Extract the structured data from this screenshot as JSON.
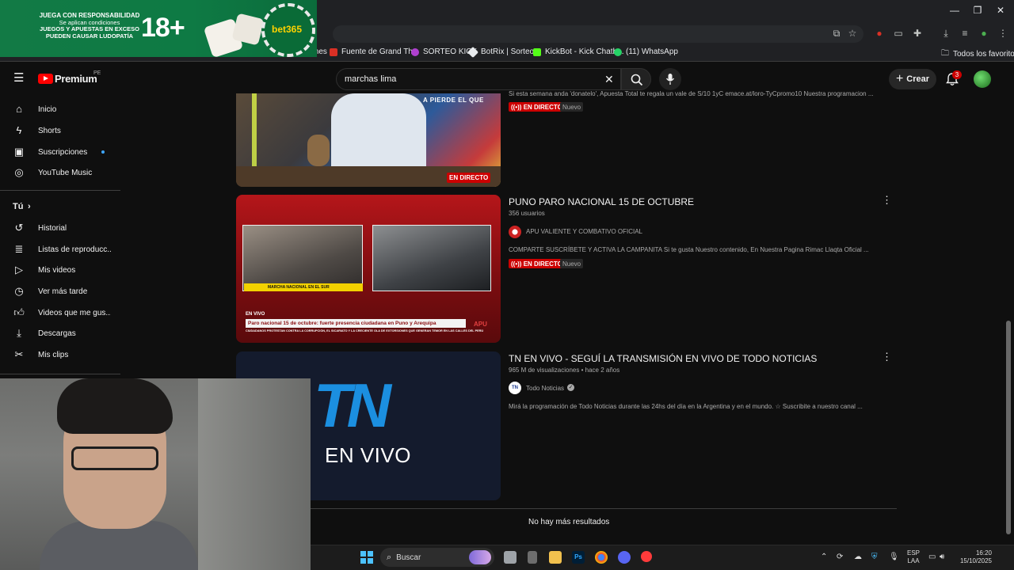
{
  "browser": {
    "bookmarks": [
      {
        "label": "ciones",
        "color": "#2f5fb3"
      },
      {
        "label": "Fuente de Grand Th...",
        "color": "#d93025"
      },
      {
        "label": "SORTEO KICK",
        "color": "#b040d0"
      },
      {
        "label": "BotRix | Sorteos",
        "color": "#e8eaed"
      },
      {
        "label": "KickBot - Kick Chatb...",
        "color": "#53fc18"
      },
      {
        "label": "(11) WhatsApp",
        "color": "#25d366"
      }
    ],
    "all_bookmarks_label": "Todos los favoritos"
  },
  "ad": {
    "line1": "JUEGA CON RESPONSABILIDAD",
    "line2": "Se aplican condiciones",
    "line3": "JUEGOS Y APUESTAS EN EXCESO",
    "line4": "PUEDEN CAUSAR LUDOPATÍA",
    "age": "18+",
    "brand": "bet365"
  },
  "header": {
    "logo_text": "Premium",
    "region": "PE",
    "search_value": "marchas lima",
    "create_label": "Crear",
    "notifications_count": "3"
  },
  "sidebar": {
    "items": [
      {
        "label": "Inicio",
        "icon": "home-icon"
      },
      {
        "label": "Shorts",
        "icon": "shorts-icon"
      },
      {
        "label": "Suscripciones",
        "icon": "subscriptions-icon"
      },
      {
        "label": "YouTube Music",
        "icon": "music-icon"
      }
    ],
    "you_label": "Tú",
    "you_items": [
      {
        "label": "Historial",
        "icon": "history-icon"
      },
      {
        "label": "Listas de reproducc...",
        "icon": "playlists-icon"
      },
      {
        "label": "Mis videos",
        "icon": "my-videos-icon"
      },
      {
        "label": "Ver más tarde",
        "icon": "watch-later-icon"
      },
      {
        "label": "Videos que me gus...",
        "icon": "liked-icon"
      },
      {
        "label": "Descargas",
        "icon": "downloads-icon"
      },
      {
        "label": "Mis clips",
        "icon": "clips-icon"
      }
    ]
  },
  "results": [
    {
      "description": "Si esta semana anda 'donatelo', Apuesta Total te regala un vale de S/10 1yC emace.at/loro-TyCpromo10 Nuestra programacion ...",
      "live_label": "EN DIRECTO",
      "new_label": "Nuevo",
      "thumb_live_label": "EN DIRECTO",
      "thumb_banner_text": "A PIERDE EL QUE"
    },
    {
      "title": "PUNO PARO NACIONAL 15 DE OCTUBRE",
      "meta": "356 usuarios",
      "channel": "APU VALIENTE Y COMBATIVO OFICIAL",
      "description": "COMPARTE SUSCRÍBETE Y ACTIVA LA CAMPANITA Si te gusta Nuestro contenido, En Nuestra Pagina Rimac Llaqta Oficial ...",
      "live_label": "EN DIRECTO",
      "new_label": "Nuevo",
      "thumb_live": "EN VIVO",
      "thumb_headline": "Paro nacional 15 de octubre: fuerte presencia ciudadana en Puno y Arequipa",
      "thumb_sub": "CIUDADANOS PROTESTAN CONTRA LA CORRUPCIÓN, EL SICARIATO Y LA CRECIENTE OLA DE EXTORSIONES QUE GENERAN TEMOR EN LAS CALLES DEL PERÚ",
      "thumb_lower": "MARCHA NACIONAL EN EL SUR",
      "thumb_brand": "APU"
    },
    {
      "title": "TN EN VIVO - SEGUÍ LA TRANSMISIÓN EN VIVO DE TODO NOTICIAS",
      "views": "965 M de visualizaciones",
      "age": "hace 2 años",
      "channel": "Todo Noticias",
      "description": "Mirá la programación de Todo Noticias durante las 24hs del día en la Argentina y en el mundo. ☆ Suscribite a nuestro canal ...",
      "thumb_logo": "TN",
      "thumb_text": "EN VIVO"
    }
  ],
  "footer_text": "No hay más resultados",
  "taskbar": {
    "search_label": "Buscar",
    "lang_line1": "ESP",
    "lang_line2": "LAA",
    "time": "16:20",
    "date": "15/10/2025"
  }
}
